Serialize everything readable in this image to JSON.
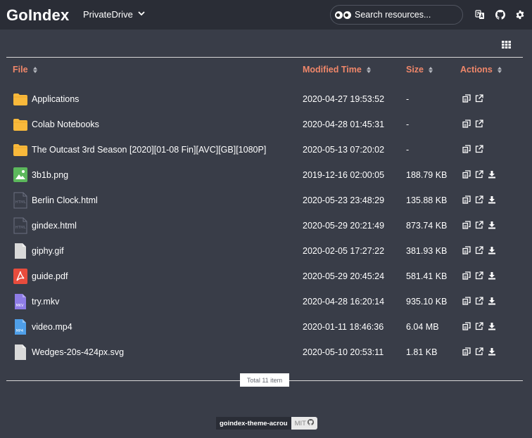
{
  "app": {
    "brand": "GoIndex",
    "drive_name": "PrivateDrive",
    "search_placeholder": "Search resources...",
    "nav_icons": [
      "translate-icon",
      "github-icon",
      "gear-icon"
    ]
  },
  "toolbar": {
    "view_toggle_icon": "grid-view-icon"
  },
  "table": {
    "columns": {
      "file": "File",
      "modified": "Modified Time",
      "size": "Size",
      "actions": "Actions"
    },
    "rows": [
      {
        "name": "Applications",
        "modified": "2020-04-27 19:53:52",
        "size": "-",
        "type": "folder",
        "download": false
      },
      {
        "name": "Colab Notebooks",
        "modified": "2020-04-28 01:45:31",
        "size": "-",
        "type": "folder",
        "download": false
      },
      {
        "name": "The Outcast 3rd Season [2020][01-08 Fin][AVC][GB][1080P]",
        "modified": "2020-05-13 07:20:02",
        "size": "-",
        "type": "folder",
        "download": false
      },
      {
        "name": "3b1b.png",
        "modified": "2019-12-16 02:00:05",
        "size": "188.79 KB",
        "type": "image",
        "download": true
      },
      {
        "name": "Berlin Clock.html",
        "modified": "2020-05-23 23:48:29",
        "size": "135.88 KB",
        "type": "html",
        "download": true
      },
      {
        "name": "gindex.html",
        "modified": "2020-05-29 20:21:49",
        "size": "873.74 KB",
        "type": "html",
        "download": true
      },
      {
        "name": "giphy.gif",
        "modified": "2020-02-05 17:27:22",
        "size": "381.93 KB",
        "type": "file",
        "download": true
      },
      {
        "name": "guide.pdf",
        "modified": "2020-05-29 20:45:24",
        "size": "581.41 KB",
        "type": "pdf",
        "download": true
      },
      {
        "name": "try.mkv",
        "modified": "2020-04-28 16:20:14",
        "size": "935.10 KB",
        "type": "mkv",
        "download": true
      },
      {
        "name": "video.mp4",
        "modified": "2020-01-11 18:46:36",
        "size": "6.04 MB",
        "type": "mp4",
        "download": true
      },
      {
        "name": "Wedges-20s-424px.svg",
        "modified": "2020-05-10 20:53:11",
        "size": "1.81 KB",
        "type": "file",
        "download": true
      }
    ]
  },
  "footer": {
    "total": "Total 11 item",
    "theme_name": "goindex-theme-acrou",
    "license": "MIT"
  },
  "colors": {
    "background": "#393d48",
    "navbar": "#2a2d36",
    "accent": "#f0876a",
    "folder": "#f9b93b",
    "image": "#5cb85c",
    "pdf": "#e84c3d",
    "mkv": "#8e7ce6",
    "mp4": "#4f9fe8"
  }
}
